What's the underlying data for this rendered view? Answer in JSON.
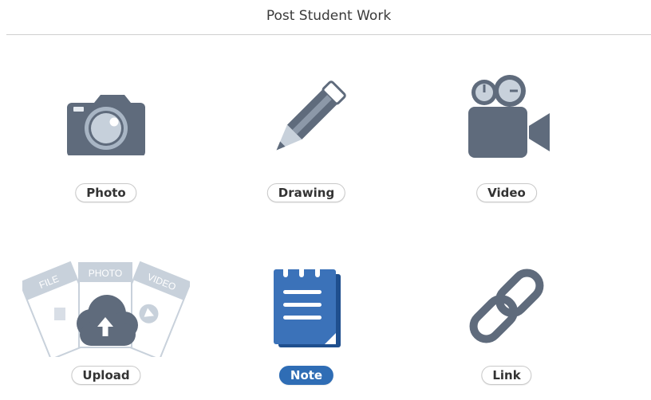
{
  "header": {
    "title": "Post Student Work"
  },
  "tiles": [
    {
      "label": "Photo",
      "icon": "camera-icon",
      "selected": false
    },
    {
      "label": "Drawing",
      "icon": "pencil-icon",
      "selected": false
    },
    {
      "label": "Video",
      "icon": "video-camera-icon",
      "selected": false
    },
    {
      "label": "Upload",
      "icon": "cloud-upload-icon",
      "selected": false,
      "card_labels": {
        "file": "FILE",
        "photo": "PHOTO",
        "video": "VIDEO"
      }
    },
    {
      "label": "Note",
      "icon": "notepad-icon",
      "selected": true
    },
    {
      "label": "Link",
      "icon": "link-icon",
      "selected": false
    }
  ],
  "colors": {
    "icon_gray": "#5f6b7c",
    "icon_light": "#c8d1db",
    "accent_blue": "#2f6db5",
    "note_blue": "#3b72b9"
  }
}
